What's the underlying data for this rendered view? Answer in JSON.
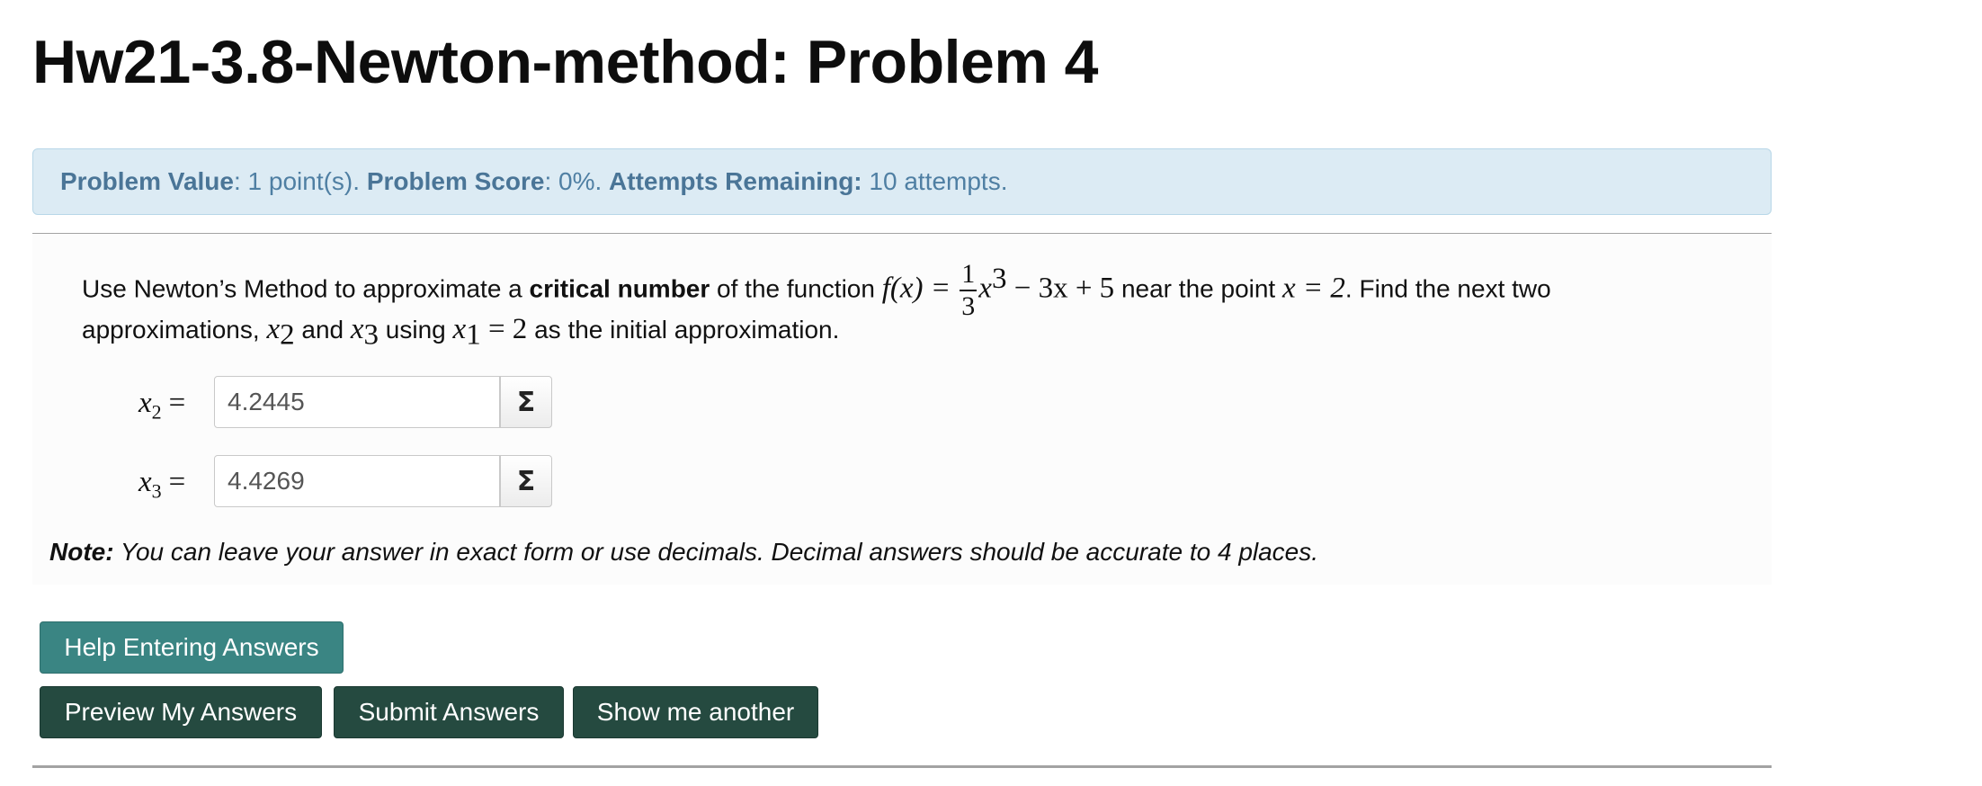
{
  "page": {
    "title": "Hw21-3.8-Newton-method: Problem 4"
  },
  "info": {
    "value_label": "Problem Value",
    "value_text": ": 1 point(s). ",
    "score_label": "Problem Score",
    "score_text": ": 0%. ",
    "attempts_label": "Attempts Remaining:",
    "attempts_text": " 10 attempts."
  },
  "problem": {
    "intro_pre": "Use Newton’s Method to approximate a ",
    "intro_bold": "critical number",
    "intro_post": " of the function ",
    "f_lhs": "f(x) = ",
    "frac_num": "1",
    "frac_den": "3",
    "x_var": "x",
    "exp": "3",
    "f_rest": " − 3x + 5",
    "near_text": " near the point ",
    "point_eq": "x = 2",
    "find_text": ". Find the next two",
    "line2_pre": "approximations, ",
    "x2_var": "x",
    "x2_sub": "2",
    "and_text": " and ",
    "x3_var": "x",
    "x3_sub": "3",
    "using_text": " using ",
    "x1_var": "x",
    "x1_sub": "1",
    "x1_eq": " = 2",
    "line2_post": " as the initial approximation."
  },
  "answers": [
    {
      "var": "x",
      "sub": "2",
      "eq": "=",
      "value": "4.2445",
      "sigma": "Σ"
    },
    {
      "var": "x",
      "sub": "3",
      "eq": "=",
      "value": "4.4269",
      "sigma": "Σ"
    }
  ],
  "note": {
    "label": "Note:",
    "text": " You can leave your answer in exact form or use decimals. Decimal answers should be accurate to 4 places."
  },
  "buttons": {
    "help": "Help Entering Answers",
    "preview": "Preview My Answers",
    "submit": "Submit Answers",
    "another": "Show me another"
  },
  "colors": {
    "info_bg": "#dcebf4",
    "info_text": "#4a7597",
    "help_button": "#3a8583",
    "dark_button": "#254a40"
  }
}
